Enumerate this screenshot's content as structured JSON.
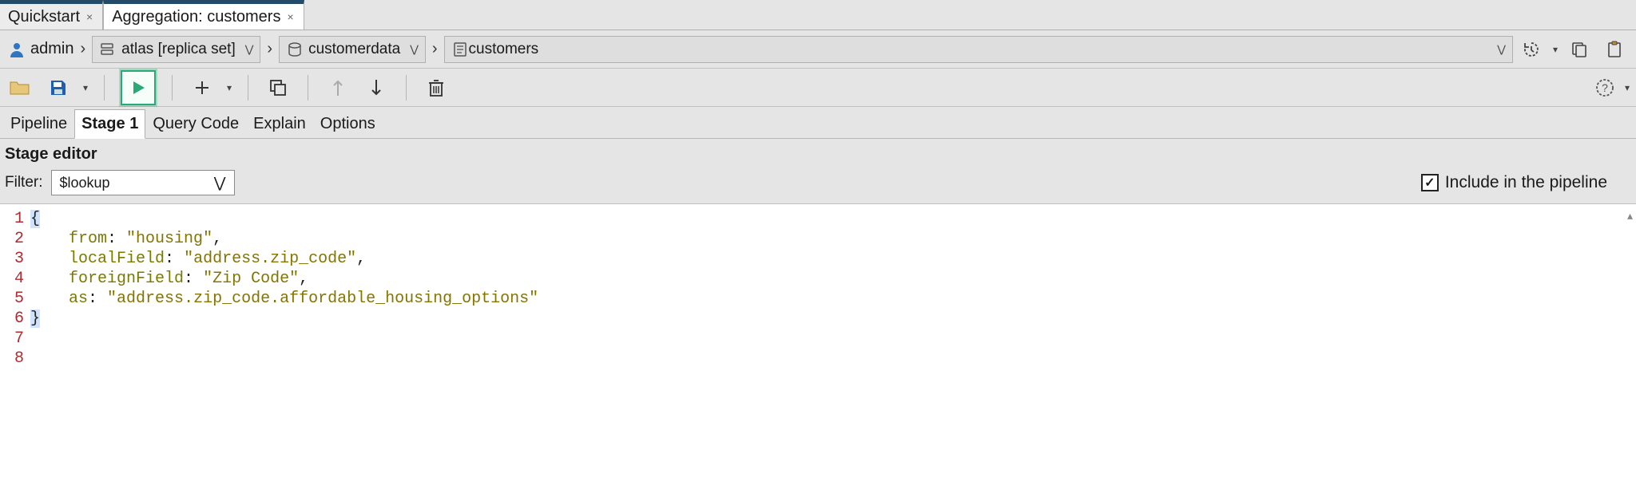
{
  "tabs": [
    {
      "label": "Quickstart"
    },
    {
      "label": "Aggregation: customers"
    }
  ],
  "breadcrumb": {
    "user": "admin",
    "cluster": "atlas [replica set]",
    "database": "customerdata",
    "collection": "customers"
  },
  "editor_tabs": [
    "Pipeline",
    "Stage 1",
    "Query Code",
    "Explain",
    "Options"
  ],
  "editor_tabs_active": "Stage 1",
  "stage": {
    "header": "Stage editor",
    "filter_label": "Filter:",
    "filter_value": "$lookup",
    "include_label": "Include in the pipeline",
    "include_checked": true
  },
  "code": {
    "lines": [
      "1",
      "2",
      "3",
      "4",
      "5",
      "6",
      "7",
      "8"
    ],
    "content": {
      "l1": "{",
      "l2_key": "from",
      "l2_val": "\"housing\"",
      "l3_key": "localField",
      "l3_val": "\"address.zip_code\"",
      "l4_key": "foreignField",
      "l4_val": "\"Zip Code\"",
      "l5_key": "as",
      "l5_val": "\"address.zip_code.affordable_housing_options\"",
      "l6": "}"
    }
  }
}
